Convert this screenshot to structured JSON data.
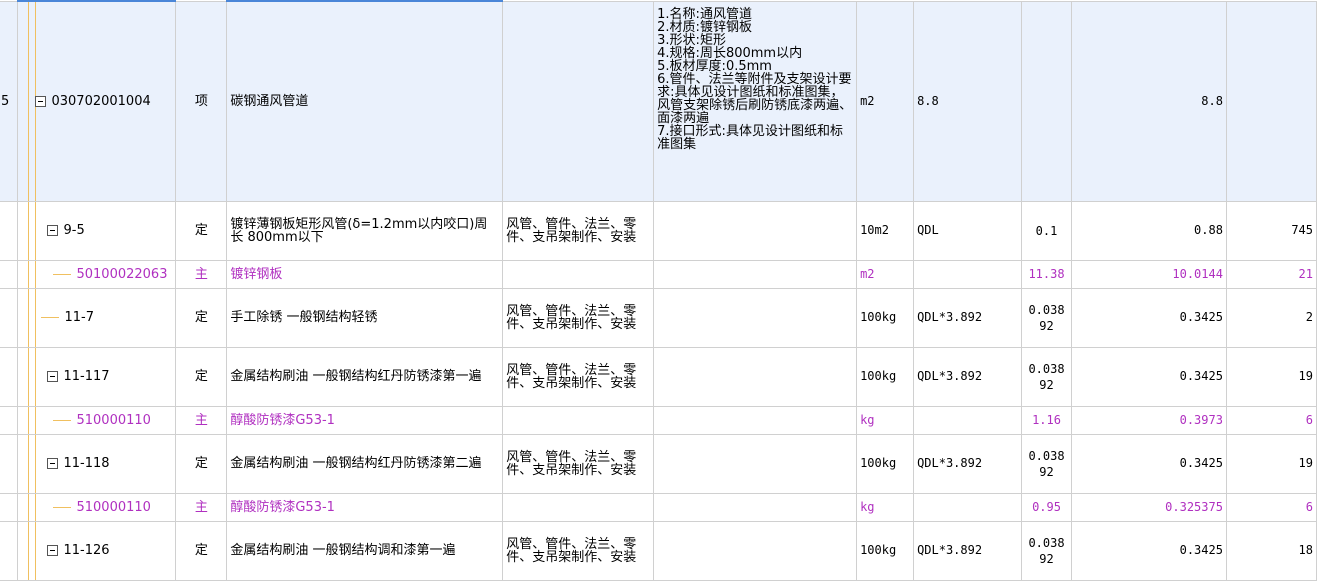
{
  "colors": {
    "selected_row_bg": "#eaf1fc",
    "material_text": "#b030c0",
    "tree_guide": "#f0c060",
    "grid_line": "#d0d0d0"
  },
  "rows": [
    {
      "idx": "5",
      "toggle": true,
      "level": 1,
      "code": "030702001004",
      "type": "项",
      "name": "碳钢通风管道",
      "work": "",
      "desc": "1.名称:通风管道\n2.材质:镀锌钢板\n3.形状:矩形\n4.规格:周长800mm以内\n5.板材厚度:0.5mm\n6.管件、法兰等附件及支架设计要求:具体见设计图纸和标准图集，风管支架除锈后刷防锈底漆两遍、面漆两遍\n7.接口形式:具体见设计图纸和标准图集",
      "unit": "m2",
      "expr": "8.8",
      "content": "",
      "qty": "8.8",
      "last": "",
      "kind": "bill"
    },
    {
      "idx": "",
      "toggle": true,
      "level": 2,
      "code": "9-5",
      "type": "定",
      "name": "镀锌薄钢板矩形风管(δ=1.2mm以内咬口)周长 800mm以下",
      "work": "风管、管件、法兰、零件、支吊架制作、安装",
      "desc": "",
      "unit": "10m2",
      "expr": "QDL",
      "content": "0.1",
      "qty": "0.88",
      "last": "745",
      "kind": "quota"
    },
    {
      "idx": "",
      "toggle": false,
      "level": 3,
      "code": "50100022063",
      "type": "主",
      "name": "镀锌钢板",
      "work": "",
      "desc": "",
      "unit": "m2",
      "expr": "",
      "content": "11.38",
      "qty": "10.0144",
      "last": "21",
      "kind": "main"
    },
    {
      "idx": "",
      "toggle": false,
      "level": 2,
      "code": "11-7",
      "type": "定",
      "name": "手工除锈 一般钢结构轻锈",
      "work": "风管、管件、法兰、零件、支吊架制作、安装",
      "desc": "",
      "unit": "100kg",
      "expr": "QDL*3.892",
      "content": "0.038\n92",
      "qty": "0.3425",
      "last": "2",
      "kind": "quota"
    },
    {
      "idx": "",
      "toggle": true,
      "level": 2,
      "code": "11-117",
      "type": "定",
      "name": "金属结构刷油 一般钢结构红丹防锈漆第一遍",
      "work": "风管、管件、法兰、零件、支吊架制作、安装",
      "desc": "",
      "unit": "100kg",
      "expr": "QDL*3.892",
      "content": "0.038\n92",
      "qty": "0.3425",
      "last": "19",
      "kind": "quota"
    },
    {
      "idx": "",
      "toggle": false,
      "level": 3,
      "code": "510000110",
      "type": "主",
      "name": "醇酸防锈漆G53-1",
      "work": "",
      "desc": "",
      "unit": "kg",
      "expr": "",
      "content": "1.16",
      "qty": "0.3973",
      "last": "6",
      "kind": "main"
    },
    {
      "idx": "",
      "toggle": true,
      "level": 2,
      "code": "11-118",
      "type": "定",
      "name": "金属结构刷油 一般钢结构红丹防锈漆第二遍",
      "work": "风管、管件、法兰、零件、支吊架制作、安装",
      "desc": "",
      "unit": "100kg",
      "expr": "QDL*3.892",
      "content": "0.038\n92",
      "qty": "0.3425",
      "last": "19",
      "kind": "quota"
    },
    {
      "idx": "",
      "toggle": false,
      "level": 3,
      "code": "510000110",
      "type": "主",
      "name": "醇酸防锈漆G53-1",
      "work": "",
      "desc": "",
      "unit": "kg",
      "expr": "",
      "content": "0.95",
      "qty": "0.325375",
      "last": "6",
      "kind": "main"
    },
    {
      "idx": "",
      "toggle": true,
      "level": 2,
      "code": "11-126",
      "type": "定",
      "name": "金属结构刷油 一般钢结构调和漆第一遍",
      "work": "风管、管件、法兰、零件、支吊架制作、安装",
      "desc": "",
      "unit": "100kg",
      "expr": "QDL*3.892",
      "content": "0.038\n92",
      "qty": "0.3425",
      "last": "18",
      "kind": "quota"
    }
  ]
}
